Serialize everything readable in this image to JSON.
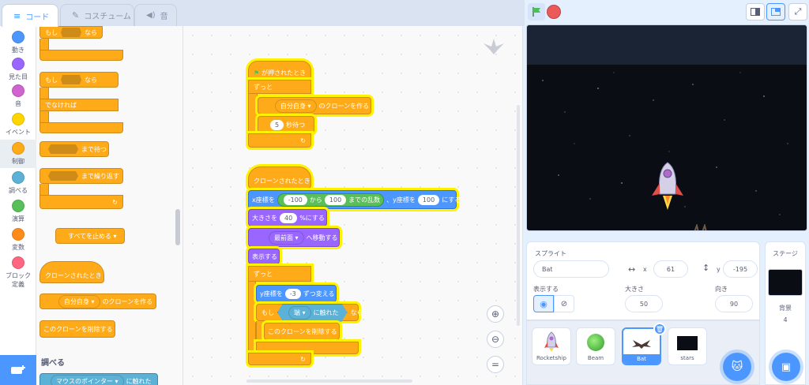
{
  "tabs": {
    "code": "コード",
    "costume": "コスチューム",
    "sound": "音"
  },
  "categories": [
    {
      "label": "動き",
      "color": "#4c97ff"
    },
    {
      "label": "見た目",
      "color": "#9966ff"
    },
    {
      "label": "音",
      "color": "#cf63cf"
    },
    {
      "label": "イベント",
      "color": "#ffd500"
    },
    {
      "label": "制御",
      "color": "#ffab19"
    },
    {
      "label": "調べる",
      "color": "#5cb1d6"
    },
    {
      "label": "演算",
      "color": "#59c059"
    },
    {
      "label": "変数",
      "color": "#ff8c1a"
    },
    {
      "label": "ブロック定義",
      "color": "#ff6680"
    }
  ],
  "palette": {
    "if_then_1_if": "もし",
    "if_then_1_then": "なら",
    "if_else_if": "もし",
    "if_else_then": "なら",
    "if_else_else": "でなければ",
    "wait_until": "まで待つ",
    "repeat_until": "まで繰り返す",
    "stop_all": "すべてを止める ▾",
    "when_clone": "クローンされたとき",
    "create_clone_dd": "自分自身 ▾",
    "create_clone_text": "のクローンを作る",
    "delete_clone": "このクローンを削除する",
    "sensing_header": "調べる",
    "touching_dd": "マウスのポインター ▾",
    "touching_text": "に触れた"
  },
  "script1": {
    "hat": "が押されたとき",
    "forever": "ずっと",
    "clone_dd": "自分自身 ▾",
    "clone_text": "のクローンを作る",
    "wait_value": "5",
    "wait_text": "秒待つ"
  },
  "script2": {
    "hat": "クローンされたとき",
    "goto_x_prefix": "x座標を",
    "rand_from": "-100",
    "rand_mid": "から",
    "rand_to": "100",
    "rand_suffix": "までの乱数",
    "goto_y_prefix": "、y座標を",
    "goto_y_value": "100",
    "goto_suffix": "にする",
    "size_prefix": "大きさを",
    "size_value": "40",
    "size_suffix": "%にする",
    "layer_dd": "最前面 ▾",
    "layer_text": "へ移動する",
    "show": "表示する",
    "forever": "ずっと",
    "change_y_prefix": "y座標を",
    "change_y_value": "-3",
    "change_y_suffix": "ずつ変える",
    "if_prefix": "もし",
    "touch_dd": "端 ▾",
    "touch_text": "に触れた",
    "if_suffix": "なら",
    "delete_clone": "このクローンを削除する"
  },
  "sprite_info": {
    "label_sprite": "スプライト",
    "sprite_name": "Bat",
    "x_label": "x",
    "x_value": "61",
    "y_label": "y",
    "y_value": "-195",
    "show_label": "表示する",
    "size_label": "大きさ",
    "size_value": "50",
    "direction_label": "向き",
    "direction_value": "90"
  },
  "sprites": [
    {
      "name": "Rocketship"
    },
    {
      "name": "Beam"
    },
    {
      "name": "Bat"
    },
    {
      "name": "stars"
    }
  ],
  "stage_panel": {
    "title": "ステージ",
    "backdrop_label": "背景",
    "backdrop_count": "4"
  }
}
